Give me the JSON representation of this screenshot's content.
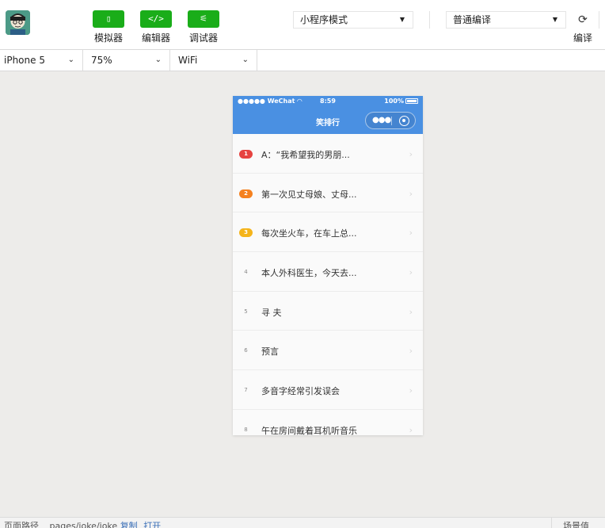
{
  "toolbar": {
    "simulator_label": "模拟器",
    "editor_label": "编辑器",
    "debugger_label": "调试器",
    "mode_select": "小程序模式",
    "compile_select": "普通编译",
    "compile_label": "编译",
    "brand_color": "#1aad19"
  },
  "device_bar": {
    "device": "iPhone 5",
    "zoom": "75%",
    "network": "WiFi"
  },
  "phone": {
    "status": {
      "carrier": "●●●●● WeChat",
      "time": "8:59",
      "battery": "100%"
    },
    "nav_title": "笑排行",
    "nav_color": "#4a90e2",
    "list": [
      {
        "rank": "1",
        "text": "A：“我希望我的男朋...",
        "badge_color": "#e64340"
      },
      {
        "rank": "2",
        "text": "第一次见丈母娘、丈母...",
        "badge_color": "#f5811f"
      },
      {
        "rank": "3",
        "text": "每次坐火车，在车上总...",
        "badge_color": "#f5b41a"
      },
      {
        "rank": "4",
        "text": "本人外科医生，今天去..."
      },
      {
        "rank": "5",
        "text": "寻 夫"
      },
      {
        "rank": "6",
        "text": "预言"
      },
      {
        "rank": "7",
        "text": "多音字经常引发误会"
      },
      {
        "rank": "8",
        "text": "午在房间戴着耳机听音乐"
      }
    ]
  },
  "bottom_bar": {
    "path_label": "页面路径",
    "path_value": "pages/joke/joke",
    "copy_link": "复制",
    "open_link": "打开",
    "scene_label": "场景值"
  }
}
